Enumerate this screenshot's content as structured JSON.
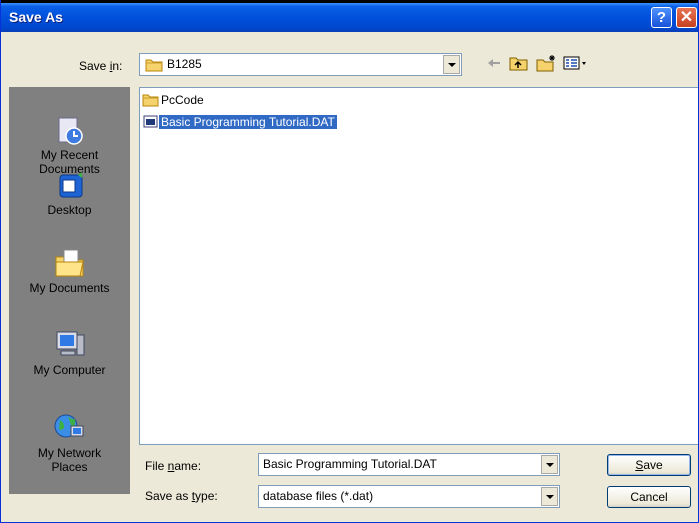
{
  "window": {
    "title": "Save As"
  },
  "titlebar_buttons": {
    "help": "?",
    "close": "✕"
  },
  "save_in": {
    "label_pre": "Save ",
    "label_acc": "i",
    "label_post": "n:",
    "value": "B1285"
  },
  "toolbar": {
    "icons": [
      "back-arrow-icon",
      "up-folder-icon",
      "new-folder-icon",
      "views-menu-icon"
    ]
  },
  "places": [
    {
      "name": "recent",
      "label_line1": "My Recent",
      "label_line2": "Documents",
      "icon": "recent-documents-icon"
    },
    {
      "name": "desktop",
      "label_line1": "Desktop",
      "label_line2": "",
      "icon": "desktop-icon"
    },
    {
      "name": "documents",
      "label_line1": "My Documents",
      "label_line2": "",
      "icon": "my-documents-icon"
    },
    {
      "name": "computer",
      "label_line1": "My Computer",
      "label_line2": "",
      "icon": "my-computer-icon"
    },
    {
      "name": "network",
      "label_line1": "My Network",
      "label_line2": "Places",
      "icon": "network-places-icon"
    }
  ],
  "files": [
    {
      "name": "PcCode",
      "type": "folder",
      "selected": false
    },
    {
      "name": "Basic Programming Tutorial.DAT",
      "type": "file",
      "selected": true
    }
  ],
  "file_name": {
    "label_pre": "File ",
    "label_acc": "n",
    "label_post": "ame:",
    "value": "Basic Programming Tutorial.DAT"
  },
  "save_as_type": {
    "label_pre": "Save as ",
    "label_acc": "t",
    "label_post": "ype:",
    "value": "database files (*.dat)"
  },
  "buttons": {
    "save_acc": "S",
    "save_rest": "ave",
    "cancel": "Cancel"
  },
  "colors": {
    "titlebar": "#0050dc",
    "selection": "#316ac5",
    "folder": "#f5d26b",
    "places_bg": "#808080"
  }
}
